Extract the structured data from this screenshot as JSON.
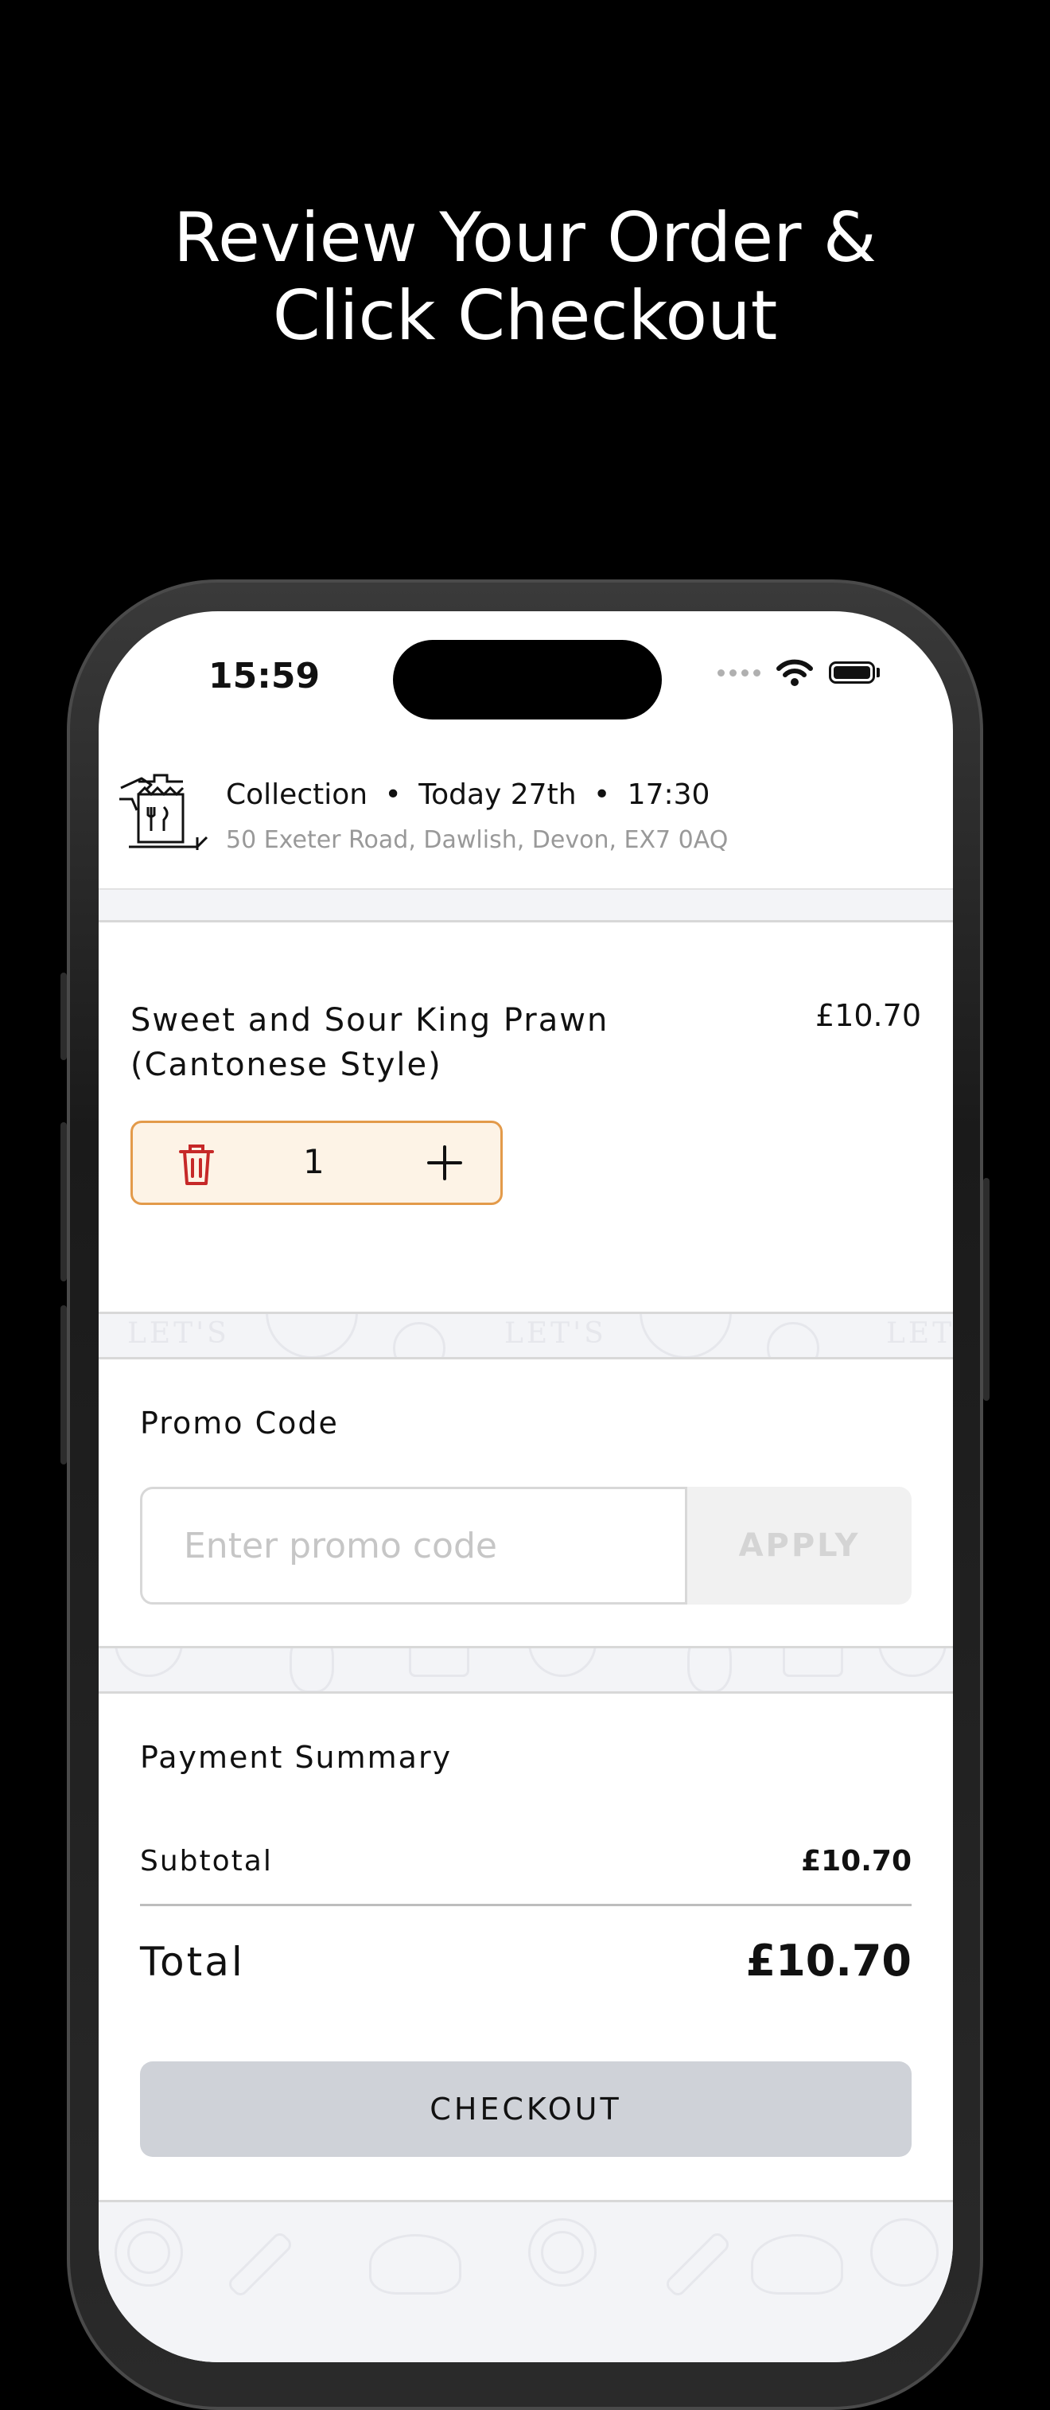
{
  "headline": {
    "line1": "Review Your Order &",
    "line2": "Click Checkout"
  },
  "status_bar": {
    "time": "15:59",
    "icons": [
      "signal-dots-icon",
      "wifi-icon",
      "battery-icon"
    ]
  },
  "order_info": {
    "mode": "Collection",
    "separator": "•",
    "day": "Today 27th",
    "time": "17:30",
    "address": "50 Exeter Road, Dawlish, Devon, EX7  0AQ",
    "icon": "takeaway-bag-icon"
  },
  "cart": {
    "items": [
      {
        "name_line1": "Sweet and Sour King Prawn",
        "name_line2": "(Cantonese Style)",
        "price": "£10.70",
        "quantity": "1"
      }
    ]
  },
  "band_text": "LET'S",
  "promo": {
    "title": "Promo Code",
    "placeholder": "Enter promo code",
    "apply_label": "APPLY"
  },
  "summary": {
    "title": "Payment Summary",
    "subtotal_label": "Subtotal",
    "subtotal_value": "£10.70",
    "total_label": "Total",
    "total_value": "£10.70",
    "checkout_label": "CHECKOUT"
  },
  "colors": {
    "accent_border": "#e39a4a",
    "accent_bg": "#fdf3e6",
    "trash_red": "#c62828",
    "checkout_bg": "#cfd2d8"
  }
}
